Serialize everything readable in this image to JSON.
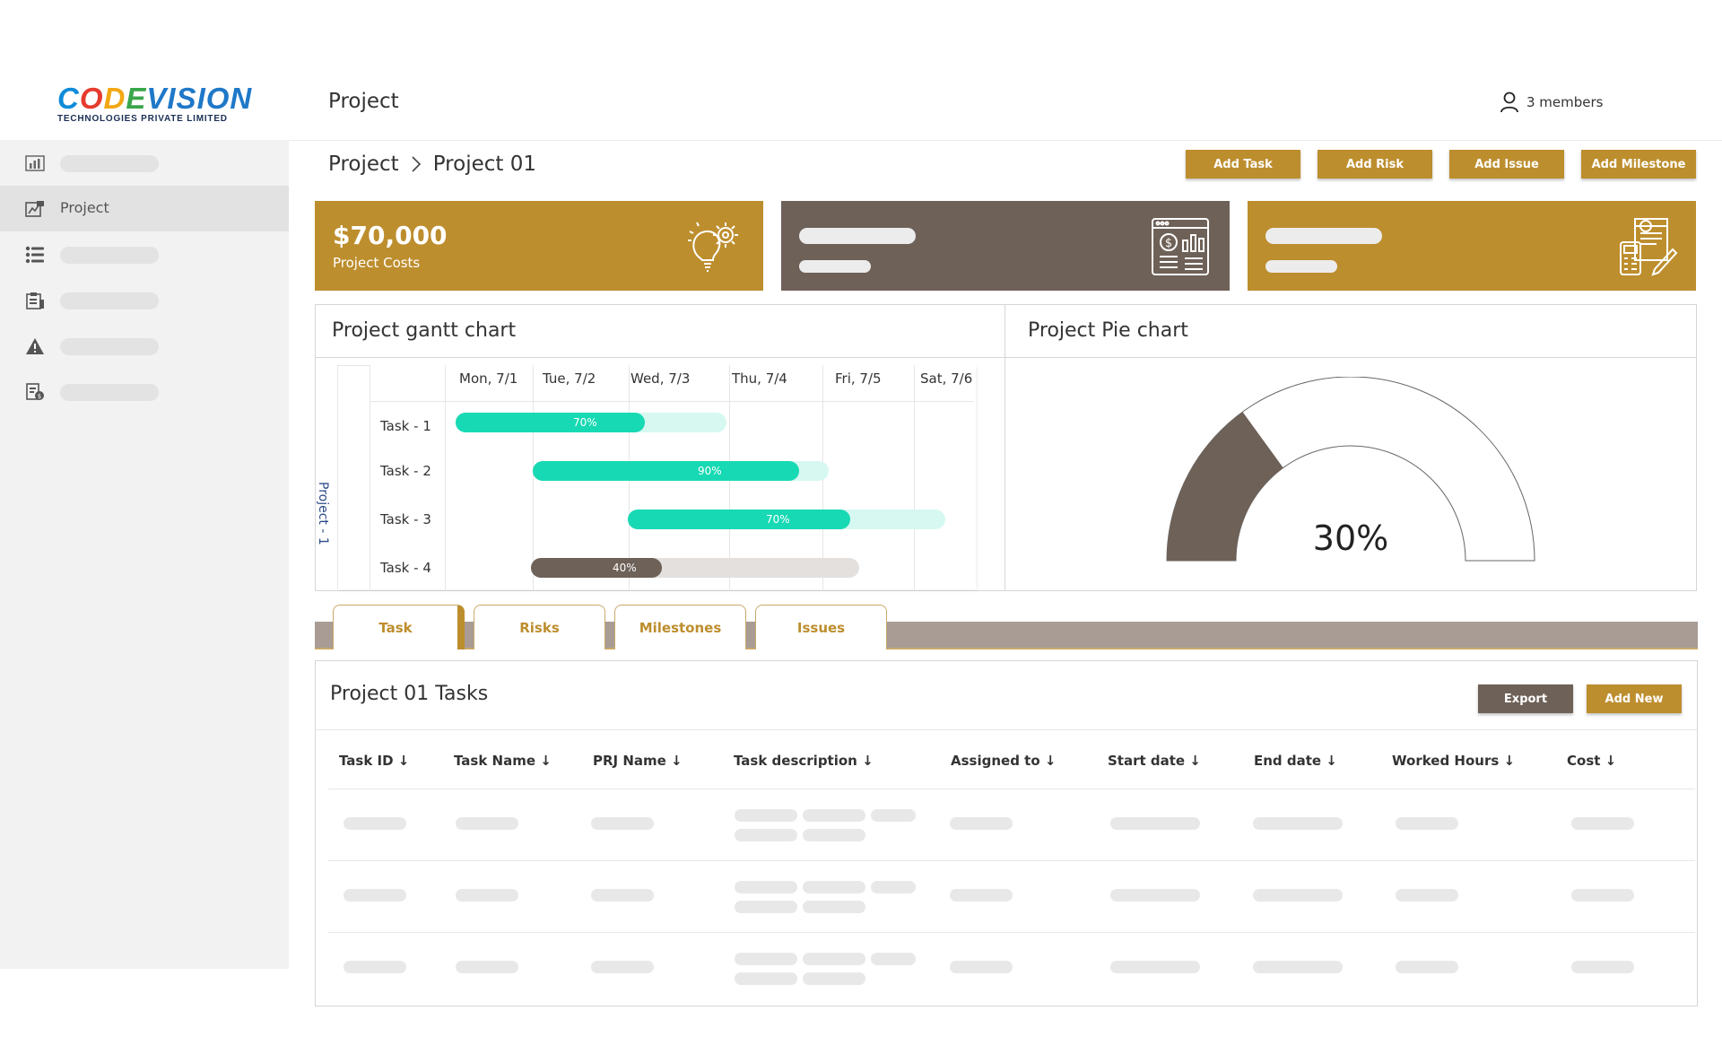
{
  "brand": {
    "logo_main": "CODEVISION",
    "logo_sub": "TECHNOLOGIES PRIVATE LIMITED"
  },
  "header": {
    "title": "Project",
    "members": "3 members"
  },
  "sidebar": {
    "items": [
      {
        "icon": "bar-chart-icon",
        "label": ""
      },
      {
        "icon": "project-icon",
        "label": "Project",
        "active": true
      },
      {
        "icon": "list-icon",
        "label": ""
      },
      {
        "icon": "clipboard-icon",
        "label": ""
      },
      {
        "icon": "warning-icon",
        "label": ""
      },
      {
        "icon": "document-money-icon",
        "label": ""
      }
    ]
  },
  "breadcrumb": {
    "root": "Project",
    "current": "Project 01"
  },
  "actions": {
    "add_task": "Add Task",
    "add_risk": "Add Risk",
    "add_issue": "Add Issue",
    "add_milestone": "Add Milestone"
  },
  "cards": {
    "cost_value": "$70,000",
    "cost_label": "Project Costs"
  },
  "gantt": {
    "title": "Project gantt chart",
    "project_label": "Project - 1",
    "days": [
      "Mon, 7/1",
      "Tue, 7/2",
      "Wed, 7/3",
      "Thu, 7/4",
      "Fri, 7/5",
      "Sat, 7/6"
    ],
    "tasks": [
      {
        "name": "Task - 1",
        "percent_label": "70%",
        "progress": 0.7
      },
      {
        "name": "Task - 2",
        "percent_label": "90%",
        "progress": 0.9
      },
      {
        "name": "Task - 3",
        "percent_label": "70%",
        "progress": 0.7
      },
      {
        "name": "Task - 4",
        "percent_label": "40%",
        "progress": 0.4
      }
    ]
  },
  "pie": {
    "title": "Project Pie chart",
    "percent_label": "30%",
    "value": 0.3,
    "fill_color": "#6e6158"
  },
  "tabs": [
    "Task",
    "Risks",
    "Milestones",
    "Issues"
  ],
  "table": {
    "title": "Project 01 Tasks",
    "export_label": "Export",
    "add_new_label": "Add New",
    "columns": [
      "Task ID ↓",
      "Task Name ↓",
      "PRJ Name ↓",
      "Task description ↓",
      "Assigned to ↓",
      "Start date ↓",
      "End date ↓",
      "Worked Hours ↓",
      "Cost ↓"
    ]
  },
  "colors": {
    "gold": "#bd8e2e",
    "brown": "#6e6158",
    "teal": "#17d9b3",
    "teal_light": "#d6f8f1"
  }
}
